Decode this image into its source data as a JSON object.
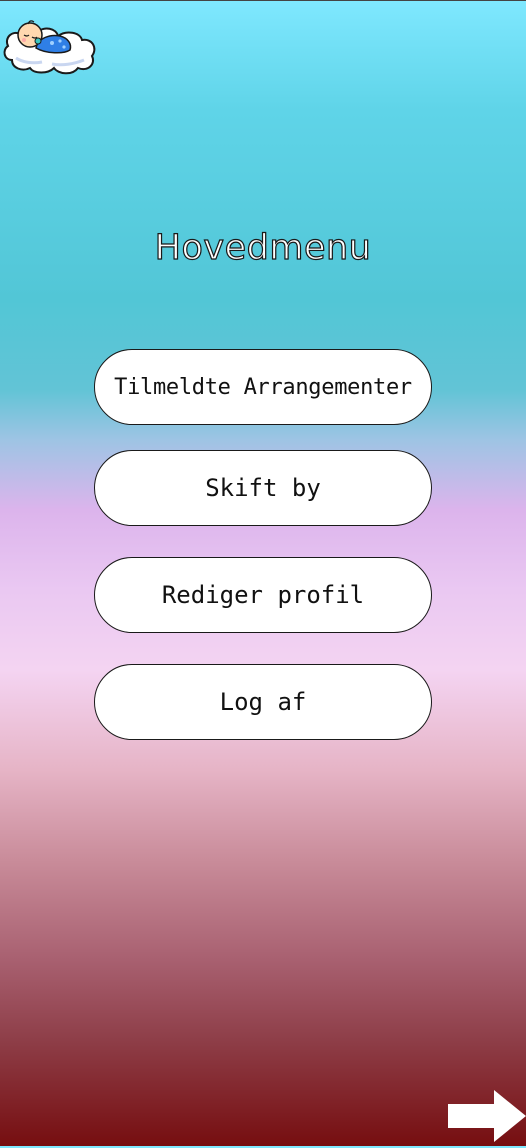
{
  "header": {
    "logo_icon": "sleeping-baby-cloud-logo"
  },
  "main": {
    "title": "Hovedmenu",
    "buttons": [
      {
        "label": "Tilmeldte Arrangementer"
      },
      {
        "label": "Skift by"
      },
      {
        "label": "Rediger profil"
      },
      {
        "label": "Log af"
      }
    ]
  },
  "footer": {
    "next_icon": "arrow-right-icon"
  },
  "colors": {
    "gradient_top": "#7fe8ff",
    "gradient_middle": "#eac8f2",
    "gradient_bottom": "#760e10",
    "button_bg": "#ffffff",
    "title_text": "#ffffff"
  }
}
